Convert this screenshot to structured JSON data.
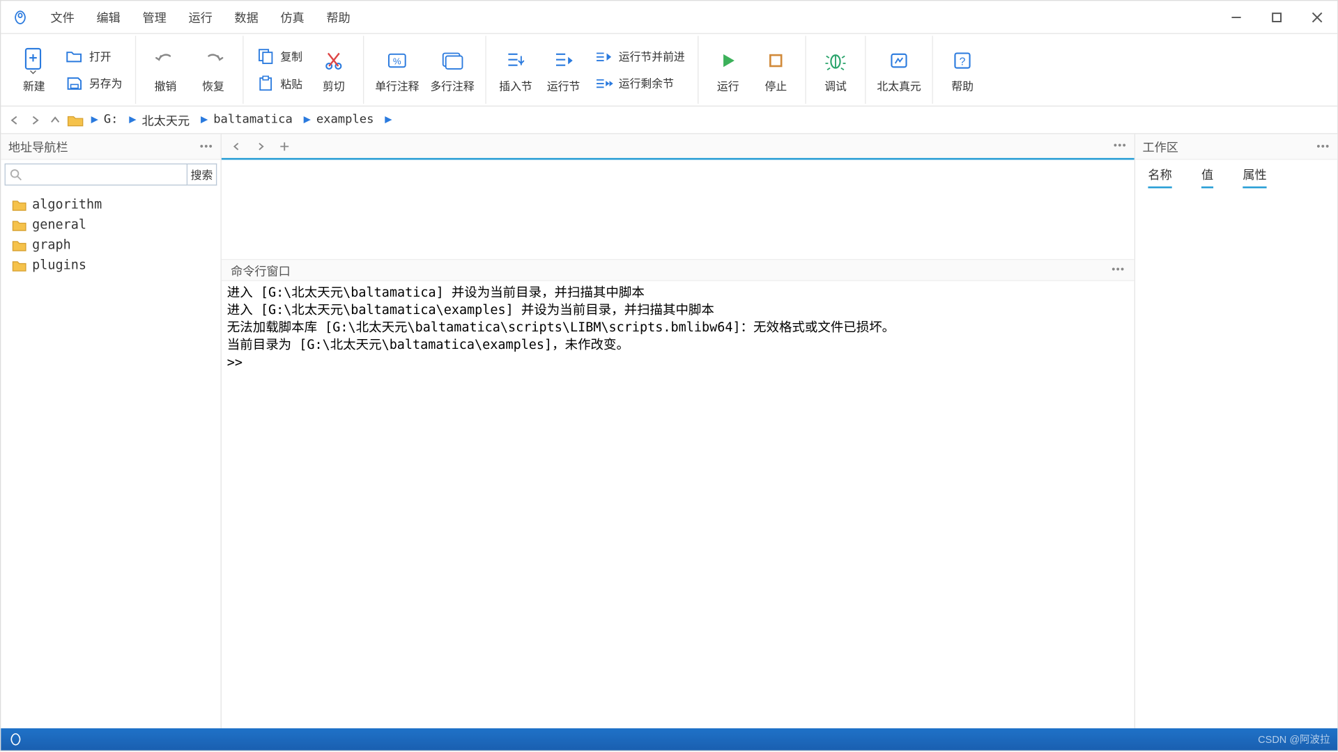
{
  "menu": {
    "items": [
      "文件",
      "编辑",
      "管理",
      "运行",
      "数据",
      "仿真",
      "帮助"
    ]
  },
  "toolbar": {
    "new": "新建",
    "open": "打开",
    "saveas": "另存为",
    "undo": "撤销",
    "redo": "恢复",
    "copy": "复制",
    "paste": "粘贴",
    "cut": "剪切",
    "comment_single": "单行注释",
    "comment_multi": "多行注释",
    "insert_section": "插入节",
    "run_section": "运行节",
    "run_section_advance": "运行节并前进",
    "run_remaining": "运行剩余节",
    "run": "运行",
    "stop": "停止",
    "debug": "调试",
    "brand": "北太真元",
    "help": "帮助"
  },
  "breadcrumb": {
    "segments": [
      "G:",
      "北太天元",
      "baltamatica",
      "examples"
    ]
  },
  "left_panel": {
    "title": "地址导航栏",
    "search_btn": "搜索",
    "folders": [
      "algorithm",
      "general",
      "graph",
      "plugins"
    ]
  },
  "command": {
    "title": "命令行窗口",
    "lines": [
      "进入 [G:\\北太天元\\baltamatica] 并设为当前目录，并扫描其中脚本",
      "进入 [G:\\北太天元\\baltamatica\\examples] 并设为当前目录，并扫描其中脚本",
      "无法加载脚本库 [G:\\北太天元\\baltamatica\\scripts\\LIBM\\scripts.bmlibw64]：无效格式或文件已损坏。",
      "当前目录为 [G:\\北太天元\\baltamatica\\examples]，未作改变。",
      ">>"
    ]
  },
  "workspace": {
    "title": "工作区",
    "tabs": [
      "名称",
      "值",
      "属性"
    ]
  },
  "watermark": "CSDN @阿波拉"
}
